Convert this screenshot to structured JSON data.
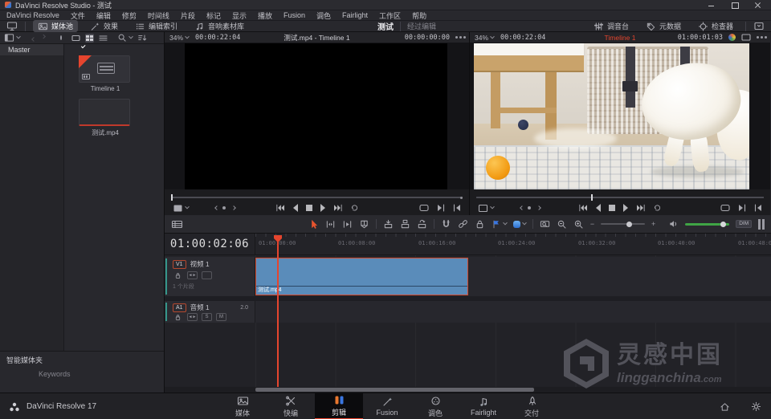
{
  "colors": {
    "accent": "#e5452e",
    "clip-blue": "#5a8cba",
    "clip-border": "#d14a2e",
    "volume-green": "#3fa445",
    "marker-blue": "#3a76e0"
  },
  "titlebar": {
    "title": "DaVinci Resolve Studio - 测试"
  },
  "menubar": {
    "items": [
      "DaVinci Resolve",
      "文件",
      "编辑",
      "修剪",
      "时间线",
      "片段",
      "标记",
      "显示",
      "播放",
      "Fusion",
      "调色",
      "Fairlight",
      "工作区",
      "帮助"
    ]
  },
  "toolbar": {
    "media_pool": "媒体池",
    "effects": "效果",
    "edit_index": "编辑索引",
    "sound_library": "音响素材库",
    "project_title": "测试",
    "project_status": "经过编辑",
    "mixer": "调音台",
    "metadata": "元数据",
    "inspector": "检查器"
  },
  "media_pool": {
    "bin_name": "Master",
    "items": [
      {
        "label": "Timeline 1"
      },
      {
        "label": "测试.mp4"
      }
    ],
    "smart_bins": "智能媒体夹",
    "keywords": "Keywords"
  },
  "source_viewer": {
    "zoom": "34%",
    "duration": "00:00:22:04",
    "title": "测试.mp4 - Timeline 1",
    "timecode": "00:00:00:00"
  },
  "record_viewer": {
    "zoom": "34%",
    "duration": "00:00:22:04",
    "title": "Timeline 1",
    "timecode": "01:00:01:03"
  },
  "timeline": {
    "playhead_timecode": "01:00:02:06",
    "ruler_ticks": [
      "01:00:00:00",
      "01:00:08:00",
      "01:00:16:00",
      "01:00:24:00",
      "01:00:32:00",
      "01:00:40:00",
      "01:00:48:00"
    ],
    "tracks": {
      "video": {
        "badge": "V1",
        "name": "视频 1",
        "clip_count": "1 个片段"
      },
      "audio": {
        "badge": "A1",
        "name": "音频 1",
        "format": "2.0",
        "solo": "S",
        "mute": "M"
      }
    },
    "clip_name": "测试.mp4",
    "dim": "DIM"
  },
  "statusbar": {
    "version": "DaVinci Resolve 17",
    "pages": [
      {
        "label": "媒体"
      },
      {
        "label": "快编"
      },
      {
        "label": "剪辑"
      },
      {
        "label": "Fusion"
      },
      {
        "label": "调色"
      },
      {
        "label": "Fairlight"
      },
      {
        "label": "交付"
      }
    ]
  },
  "watermark": {
    "cn": "灵感中国",
    "en": "lingganchina",
    "suffix": ".com"
  }
}
